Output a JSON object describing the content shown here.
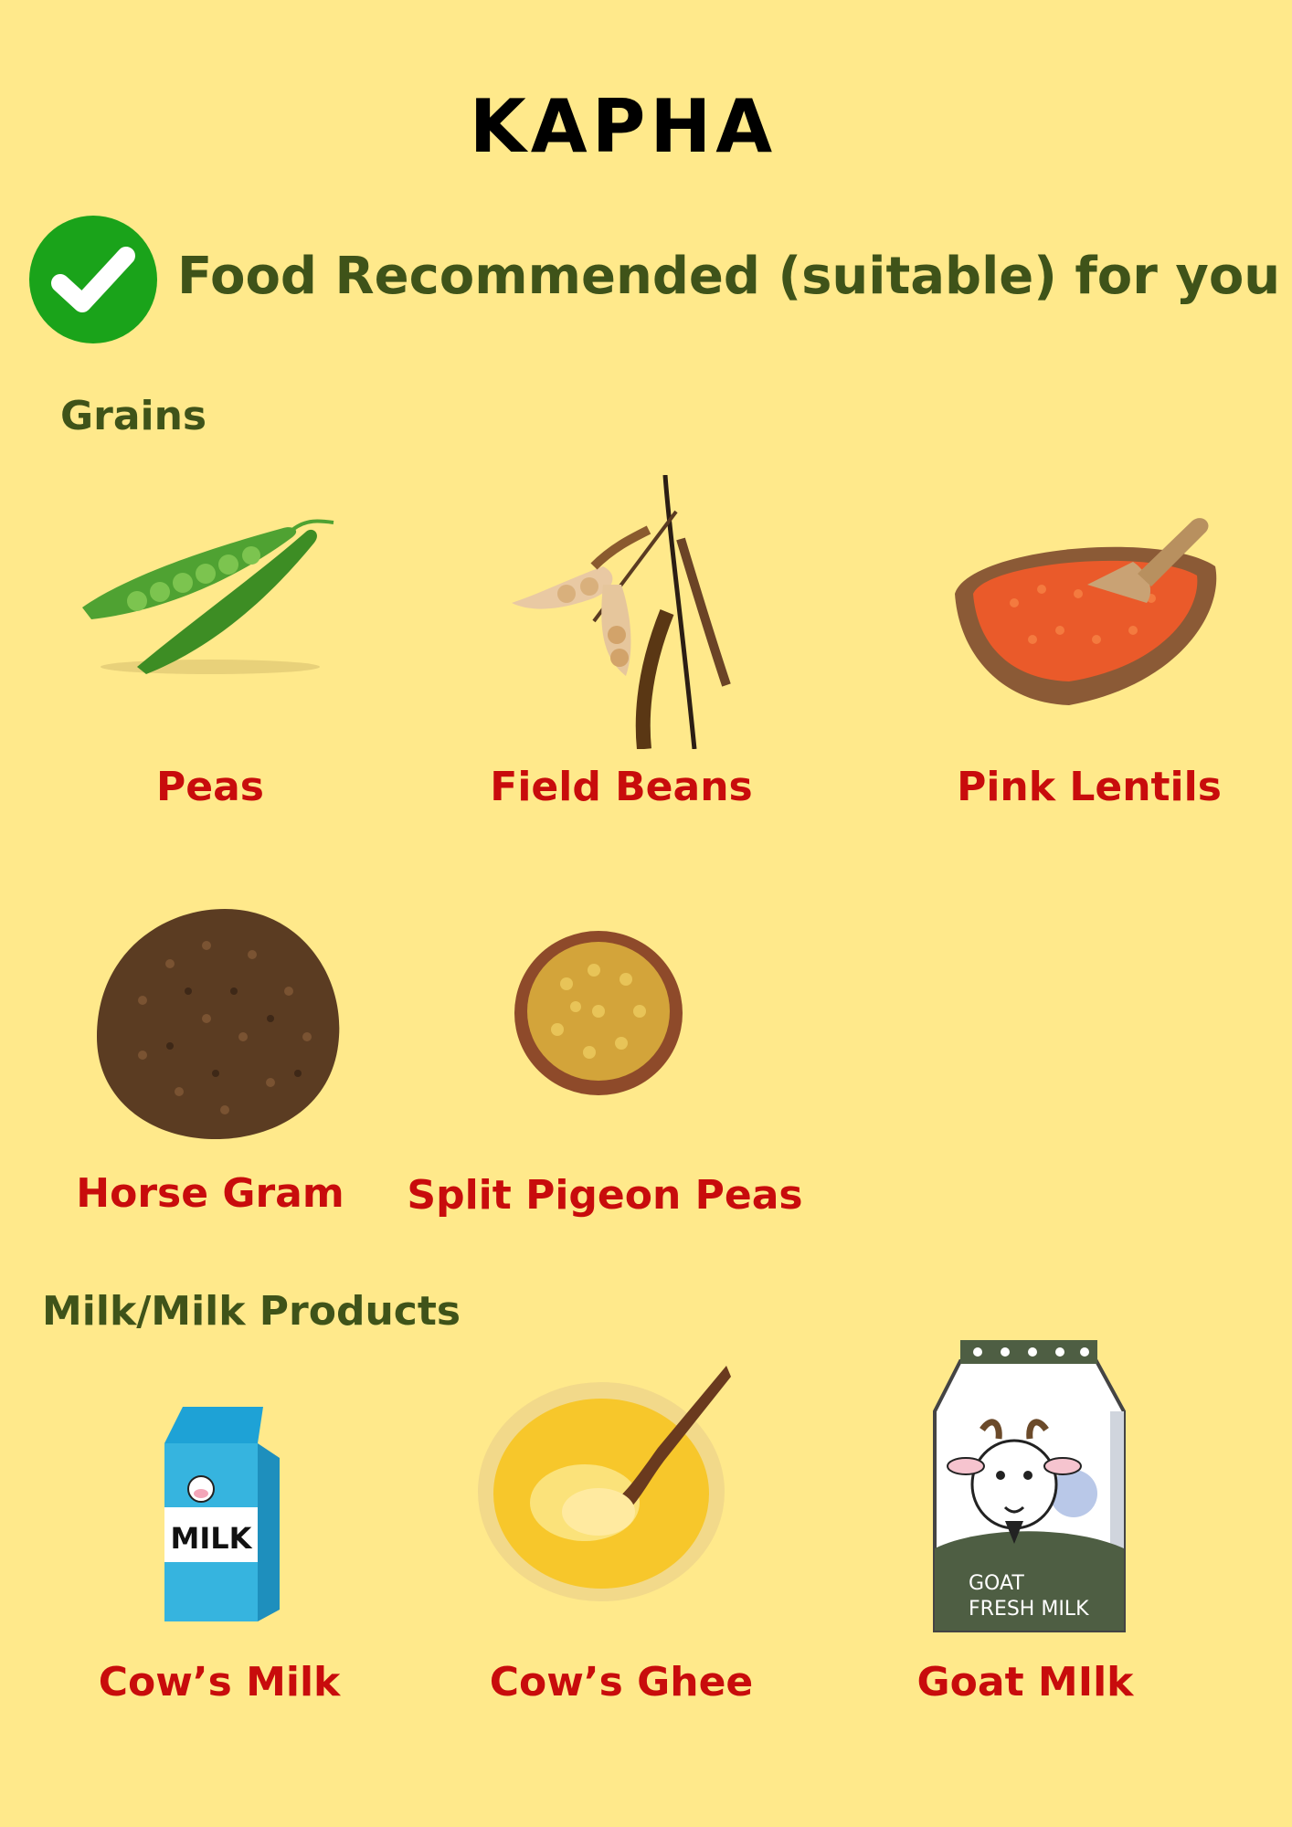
{
  "title": "KAPHA",
  "subtitle": "Food Recommended (suitable) for you :",
  "colors": {
    "background": "#ffe98b",
    "heading_green": "#3f5319",
    "label_red": "#c80c0c",
    "check_green": "#1aa31a"
  },
  "sections": [
    {
      "heading": "Grains",
      "items": [
        {
          "label": "Peas",
          "icon": "peas-icon"
        },
        {
          "label": "Field Beans",
          "icon": "field-beans-icon"
        },
        {
          "label": "Pink Lentils",
          "icon": "pink-lentils-icon"
        },
        {
          "label": "Horse Gram",
          "icon": "horse-gram-icon"
        },
        {
          "label": "Split Pigeon Peas",
          "icon": "split-pigeon-peas-icon"
        }
      ]
    },
    {
      "heading": "Milk/Milk Products",
      "items": [
        {
          "label": "Cow’s Milk",
          "icon": "milk-carton-icon"
        },
        {
          "label": "Cow’s Ghee",
          "icon": "ghee-jar-icon"
        },
        {
          "label": "Goat MIlk",
          "icon": "goat-milk-pack-icon"
        }
      ]
    }
  ],
  "goat_pack_text": [
    "GOAT",
    "FRESH MILK"
  ],
  "milk_carton_text": "MILK"
}
